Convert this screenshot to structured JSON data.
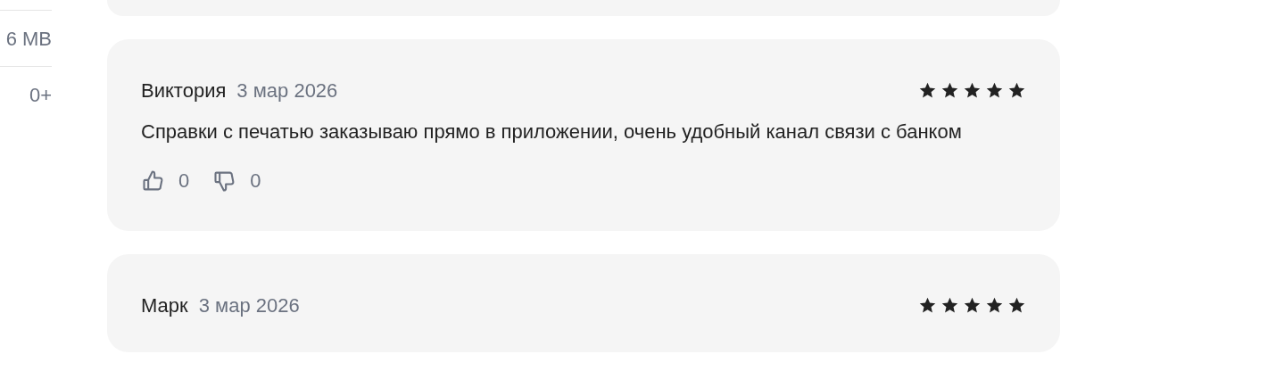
{
  "app_info": [
    {
      "value": "6 MB"
    },
    {
      "value": "0+"
    }
  ],
  "reviews": [
    {
      "author": "Виктория",
      "date": "3 мар 2026",
      "stars": 5,
      "text": "Справки с печатью заказываю прямо в приложении, очень удобный канал связи с банком",
      "likes": "0",
      "dislikes": "0"
    },
    {
      "author": "Марк",
      "date": "3 мар 2026",
      "stars": 5
    }
  ]
}
